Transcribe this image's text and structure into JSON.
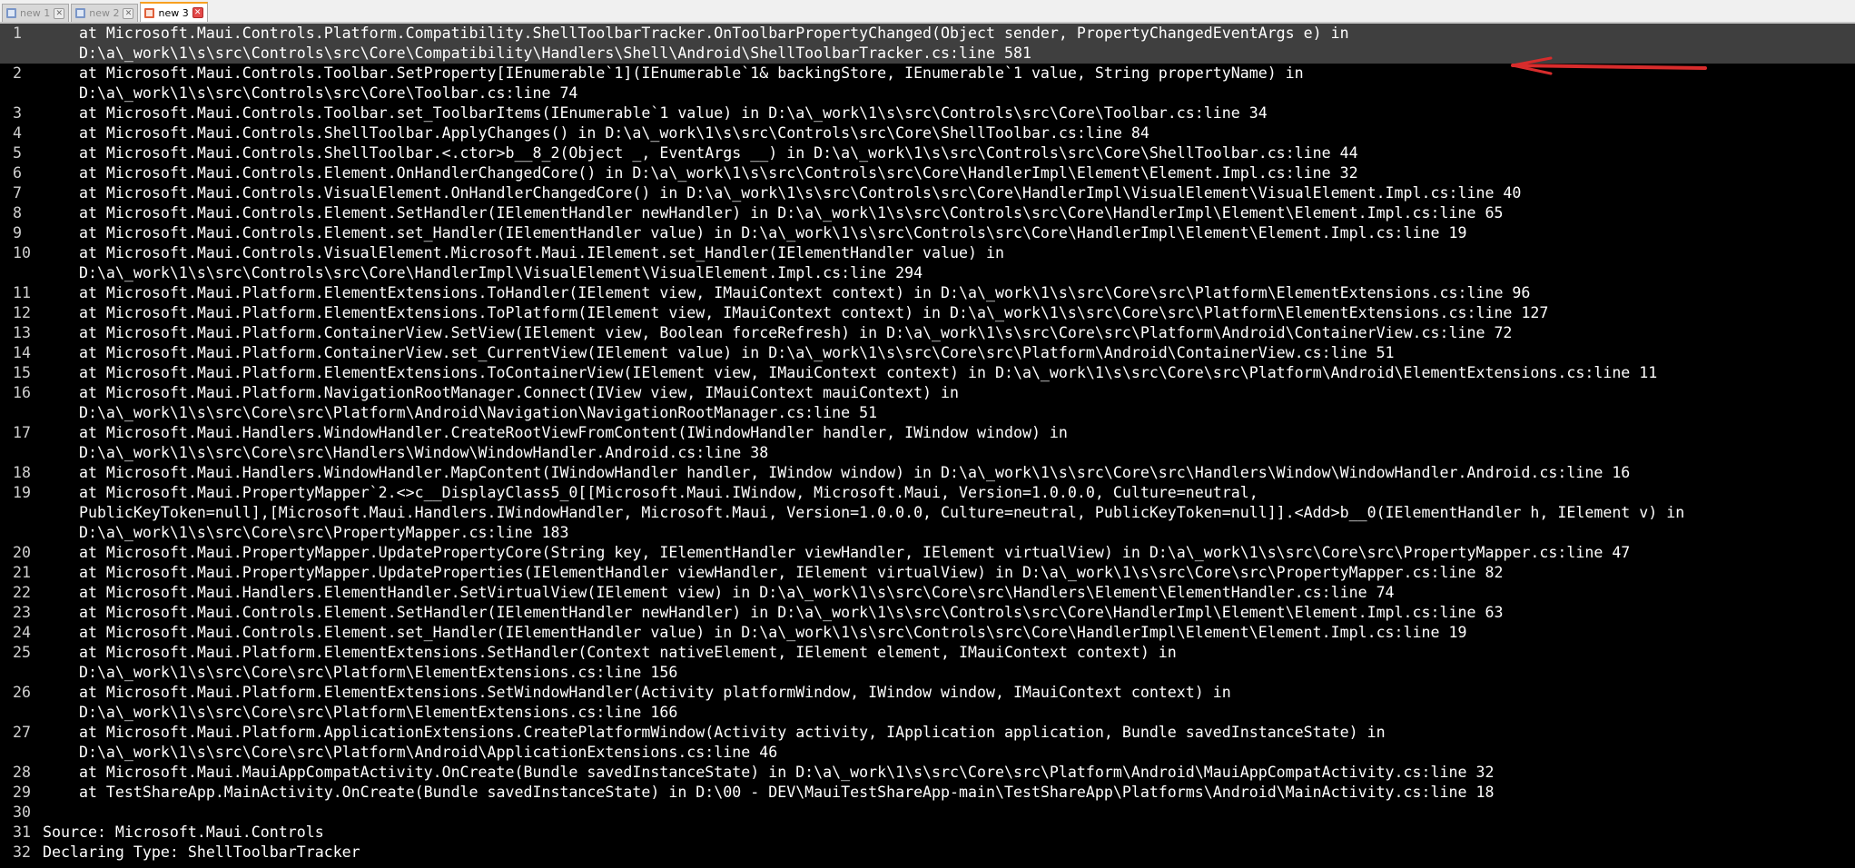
{
  "tabs": [
    {
      "label": "new 1",
      "active": false
    },
    {
      "label": "new 2",
      "active": false
    },
    {
      "label": "new 3",
      "active": true
    }
  ],
  "annotation_color": "#d72c2c",
  "lines": [
    {
      "num": "1",
      "text": "    at Microsoft.Maui.Controls.Platform.Compatibility.ShellToolbarTracker.OnToolbarPropertyChanged(Object sender, PropertyChangedEventArgs e) in"
    },
    {
      "num": "",
      "text": "    D:\\a\\_work\\1\\s\\src\\Controls\\src\\Core\\Compatibility\\Handlers\\Shell\\Android\\ShellToolbarTracker.cs:line 581"
    },
    {
      "num": "2",
      "text": "    at Microsoft.Maui.Controls.Toolbar.SetProperty[IEnumerable`1](IEnumerable`1& backingStore, IEnumerable`1 value, String propertyName) in"
    },
    {
      "num": "",
      "text": "    D:\\a\\_work\\1\\s\\src\\Controls\\src\\Core\\Toolbar.cs:line 74"
    },
    {
      "num": "3",
      "text": "    at Microsoft.Maui.Controls.Toolbar.set_ToolbarItems(IEnumerable`1 value) in D:\\a\\_work\\1\\s\\src\\Controls\\src\\Core\\Toolbar.cs:line 34"
    },
    {
      "num": "4",
      "text": "    at Microsoft.Maui.Controls.ShellToolbar.ApplyChanges() in D:\\a\\_work\\1\\s\\src\\Controls\\src\\Core\\ShellToolbar.cs:line 84"
    },
    {
      "num": "5",
      "text": "    at Microsoft.Maui.Controls.ShellToolbar.<.ctor>b__8_2(Object _, EventArgs __) in D:\\a\\_work\\1\\s\\src\\Controls\\src\\Core\\ShellToolbar.cs:line 44"
    },
    {
      "num": "6",
      "text": "    at Microsoft.Maui.Controls.Element.OnHandlerChangedCore() in D:\\a\\_work\\1\\s\\src\\Controls\\src\\Core\\HandlerImpl\\Element\\Element.Impl.cs:line 32"
    },
    {
      "num": "7",
      "text": "    at Microsoft.Maui.Controls.VisualElement.OnHandlerChangedCore() in D:\\a\\_work\\1\\s\\src\\Controls\\src\\Core\\HandlerImpl\\VisualElement\\VisualElement.Impl.cs:line 40"
    },
    {
      "num": "8",
      "text": "    at Microsoft.Maui.Controls.Element.SetHandler(IElementHandler newHandler) in D:\\a\\_work\\1\\s\\src\\Controls\\src\\Core\\HandlerImpl\\Element\\Element.Impl.cs:line 65"
    },
    {
      "num": "9",
      "text": "    at Microsoft.Maui.Controls.Element.set_Handler(IElementHandler value) in D:\\a\\_work\\1\\s\\src\\Controls\\src\\Core\\HandlerImpl\\Element\\Element.Impl.cs:line 19"
    },
    {
      "num": "10",
      "text": "    at Microsoft.Maui.Controls.VisualElement.Microsoft.Maui.IElement.set_Handler(IElementHandler value) in"
    },
    {
      "num": "",
      "text": "    D:\\a\\_work\\1\\s\\src\\Controls\\src\\Core\\HandlerImpl\\VisualElement\\VisualElement.Impl.cs:line 294"
    },
    {
      "num": "11",
      "text": "    at Microsoft.Maui.Platform.ElementExtensions.ToHandler(IElement view, IMauiContext context) in D:\\a\\_work\\1\\s\\src\\Core\\src\\Platform\\ElementExtensions.cs:line 96"
    },
    {
      "num": "12",
      "text": "    at Microsoft.Maui.Platform.ElementExtensions.ToPlatform(IElement view, IMauiContext context) in D:\\a\\_work\\1\\s\\src\\Core\\src\\Platform\\ElementExtensions.cs:line 127"
    },
    {
      "num": "13",
      "text": "    at Microsoft.Maui.Platform.ContainerView.SetView(IElement view, Boolean forceRefresh) in D:\\a\\_work\\1\\s\\src\\Core\\src\\Platform\\Android\\ContainerView.cs:line 72"
    },
    {
      "num": "14",
      "text": "    at Microsoft.Maui.Platform.ContainerView.set_CurrentView(IElement value) in D:\\a\\_work\\1\\s\\src\\Core\\src\\Platform\\Android\\ContainerView.cs:line 51"
    },
    {
      "num": "15",
      "text": "    at Microsoft.Maui.Platform.ElementExtensions.ToContainerView(IElement view, IMauiContext context) in D:\\a\\_work\\1\\s\\src\\Core\\src\\Platform\\Android\\ElementExtensions.cs:line 11"
    },
    {
      "num": "16",
      "text": "    at Microsoft.Maui.Platform.NavigationRootManager.Connect(IView view, IMauiContext mauiContext) in"
    },
    {
      "num": "",
      "text": "    D:\\a\\_work\\1\\s\\src\\Core\\src\\Platform\\Android\\Navigation\\NavigationRootManager.cs:line 51"
    },
    {
      "num": "17",
      "text": "    at Microsoft.Maui.Handlers.WindowHandler.CreateRootViewFromContent(IWindowHandler handler, IWindow window) in"
    },
    {
      "num": "",
      "text": "    D:\\a\\_work\\1\\s\\src\\Core\\src\\Handlers\\Window\\WindowHandler.Android.cs:line 38"
    },
    {
      "num": "18",
      "text": "    at Microsoft.Maui.Handlers.WindowHandler.MapContent(IWindowHandler handler, IWindow window) in D:\\a\\_work\\1\\s\\src\\Core\\src\\Handlers\\Window\\WindowHandler.Android.cs:line 16"
    },
    {
      "num": "19",
      "text": "    at Microsoft.Maui.PropertyMapper`2.<>c__DisplayClass5_0[[Microsoft.Maui.IWindow, Microsoft.Maui, Version=1.0.0.0, Culture=neutral,"
    },
    {
      "num": "",
      "text": "    PublicKeyToken=null],[Microsoft.Maui.Handlers.IWindowHandler, Microsoft.Maui, Version=1.0.0.0, Culture=neutral, PublicKeyToken=null]].<Add>b__0(IElementHandler h, IElement v) in"
    },
    {
      "num": "",
      "text": "    D:\\a\\_work\\1\\s\\src\\Core\\src\\PropertyMapper.cs:line 183"
    },
    {
      "num": "20",
      "text": "    at Microsoft.Maui.PropertyMapper.UpdatePropertyCore(String key, IElementHandler viewHandler, IElement virtualView) in D:\\a\\_work\\1\\s\\src\\Core\\src\\PropertyMapper.cs:line 47"
    },
    {
      "num": "21",
      "text": "    at Microsoft.Maui.PropertyMapper.UpdateProperties(IElementHandler viewHandler, IElement virtualView) in D:\\a\\_work\\1\\s\\src\\Core\\src\\PropertyMapper.cs:line 82"
    },
    {
      "num": "22",
      "text": "    at Microsoft.Maui.Handlers.ElementHandler.SetVirtualView(IElement view) in D:\\a\\_work\\1\\s\\src\\Core\\src\\Handlers\\Element\\ElementHandler.cs:line 74"
    },
    {
      "num": "23",
      "text": "    at Microsoft.Maui.Controls.Element.SetHandler(IElementHandler newHandler) in D:\\a\\_work\\1\\s\\src\\Controls\\src\\Core\\HandlerImpl\\Element\\Element.Impl.cs:line 63"
    },
    {
      "num": "24",
      "text": "    at Microsoft.Maui.Controls.Element.set_Handler(IElementHandler value) in D:\\a\\_work\\1\\s\\src\\Controls\\src\\Core\\HandlerImpl\\Element\\Element.Impl.cs:line 19"
    },
    {
      "num": "25",
      "text": "    at Microsoft.Maui.Platform.ElementExtensions.SetHandler(Context nativeElement, IElement element, IMauiContext context) in"
    },
    {
      "num": "",
      "text": "    D:\\a\\_work\\1\\s\\src\\Core\\src\\Platform\\ElementExtensions.cs:line 156"
    },
    {
      "num": "26",
      "text": "    at Microsoft.Maui.Platform.ElementExtensions.SetWindowHandler(Activity platformWindow, IWindow window, IMauiContext context) in"
    },
    {
      "num": "",
      "text": "    D:\\a\\_work\\1\\s\\src\\Core\\src\\Platform\\ElementExtensions.cs:line 166"
    },
    {
      "num": "27",
      "text": "    at Microsoft.Maui.Platform.ApplicationExtensions.CreatePlatformWindow(Activity activity, IApplication application, Bundle savedInstanceState) in"
    },
    {
      "num": "",
      "text": "    D:\\a\\_work\\1\\s\\src\\Core\\src\\Platform\\Android\\ApplicationExtensions.cs:line 46"
    },
    {
      "num": "28",
      "text": "    at Microsoft.Maui.MauiAppCompatActivity.OnCreate(Bundle savedInstanceState) in D:\\a\\_work\\1\\s\\src\\Core\\src\\Platform\\Android\\MauiAppCompatActivity.cs:line 32"
    },
    {
      "num": "29",
      "text": "    at TestShareApp.MainActivity.OnCreate(Bundle savedInstanceState) in D:\\00 - DEV\\MauiTestShareApp-main\\TestShareApp\\Platforms\\Android\\MainActivity.cs:line 18"
    },
    {
      "num": "30",
      "text": ""
    },
    {
      "num": "31",
      "text": "Source: Microsoft.Maui.Controls"
    },
    {
      "num": "32",
      "text": "Declaring Type: ShellToolbarTracker"
    }
  ]
}
